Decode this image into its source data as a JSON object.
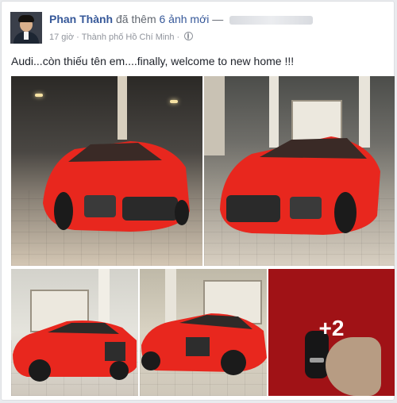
{
  "post": {
    "author": "Phan Thành",
    "action": "đã thêm",
    "photos_link": "6 ảnh mới",
    "dash": "—",
    "time": "17 giờ",
    "dot": "·",
    "location": "Thành phố Hồ Chí Minh",
    "caption": "Audi...còn thiếu tên em....finally, welcome to new home !!!",
    "more_photos": "+2"
  },
  "icons": {
    "avatar": "profile-photo",
    "privacy": "globe-icon"
  },
  "colors": {
    "car_red": "#e8271e",
    "link_blue": "#365899"
  }
}
